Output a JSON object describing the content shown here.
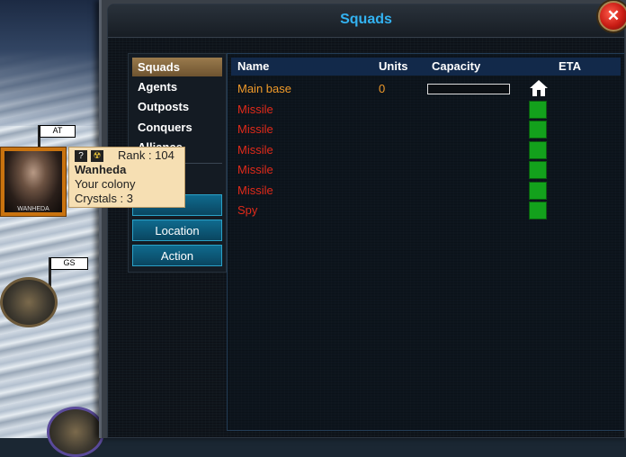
{
  "window": {
    "title": "Squads"
  },
  "menu": {
    "items": [
      {
        "label": "Squads",
        "active": true
      },
      {
        "label": "Agents",
        "active": false
      },
      {
        "label": "Outposts",
        "active": false
      },
      {
        "label": "Conquers",
        "active": false
      },
      {
        "label": "Alliance",
        "active": false
      }
    ],
    "buttons": [
      {
        "label": "Location"
      },
      {
        "label": "Action"
      }
    ]
  },
  "table": {
    "headers": {
      "name": "Name",
      "units": "Units",
      "capacity": "Capacity",
      "eta": "ETA"
    },
    "rows": [
      {
        "name": "Main base",
        "units": "0",
        "color": "#f09a2a",
        "eta_icon": "home-icon",
        "capacity_fraction": 0
      },
      {
        "name": "Missile",
        "units": "",
        "color": "#e02a1a",
        "eta_icon": "green-status-icon"
      },
      {
        "name": "Missile",
        "units": "",
        "color": "#e02a1a",
        "eta_icon": "green-status-icon"
      },
      {
        "name": "Missile",
        "units": "",
        "color": "#e02a1a",
        "eta_icon": "green-status-icon"
      },
      {
        "name": "Missile",
        "units": "",
        "color": "#e02a1a",
        "eta_icon": "green-status-icon"
      },
      {
        "name": "Missile",
        "units": "",
        "color": "#e02a1a",
        "eta_icon": "green-status-icon"
      },
      {
        "name": "Spy",
        "units": "",
        "color": "#e02a1a",
        "eta_icon": "green-status-icon"
      }
    ]
  },
  "player": {
    "name": "Wanheda",
    "rank": "Rank : 104",
    "colony": "Your colony",
    "crystals": "Crystals : 3",
    "help_icon": "?",
    "avatar_caption": "WANHEDA"
  },
  "map_flags": [
    {
      "label": "AT"
    },
    {
      "label": "GS"
    }
  ],
  "colors": {
    "title": "#33b3f2",
    "active_menu": "#8a6a3f",
    "button": "#0f6a8e",
    "eta_green": "#13a11c"
  }
}
